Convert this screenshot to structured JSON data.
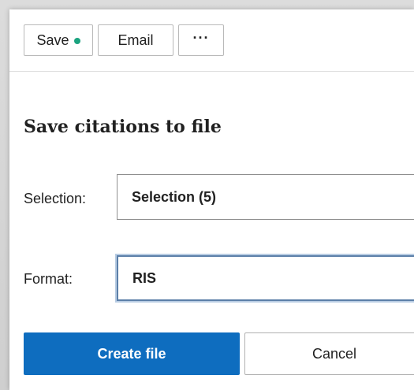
{
  "toolbar": {
    "save_label": "Save",
    "save_status_icon": "status-dot-icon",
    "email_label": "Email",
    "more_label": "···",
    "more_icon": "more-options-icon"
  },
  "dialog": {
    "title": "Save citations to file",
    "selection_label": "Selection:",
    "selection_value": "Selection (5)",
    "format_label": "Format:",
    "format_value": "RIS",
    "create_button": "Create file",
    "cancel_button": "Cancel"
  },
  "colors": {
    "status_dot": "#1ba37f",
    "primary": "#0e6dbf",
    "focus_border": "#5b7fa8"
  }
}
